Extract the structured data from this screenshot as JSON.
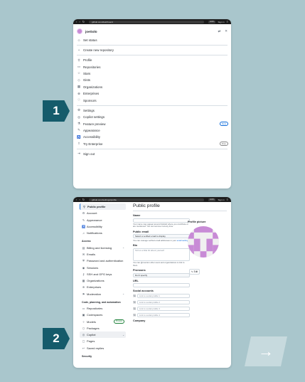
{
  "browser": {
    "url_top": "github.com/dashboard",
    "url_bottom": "github.com/settings/profile",
    "pill1": "100%",
    "pill2": "Sign in"
  },
  "menu": {
    "username": "joeSolo",
    "items_group1": [
      {
        "icon": "smiley-icon",
        "glyph": "☺",
        "label": "Set status"
      }
    ],
    "items_group2": [
      {
        "icon": "plus-icon",
        "glyph": "+",
        "label": "Create new repository"
      }
    ],
    "items_group3": [
      {
        "icon": "person-icon",
        "glyph": "⚲",
        "label": "Profile"
      },
      {
        "icon": "repo-icon",
        "glyph": "▭",
        "label": "Repositories"
      },
      {
        "icon": "star-icon",
        "glyph": "☆",
        "label": "Stars"
      },
      {
        "icon": "gist-icon",
        "glyph": "◇",
        "label": "Gists"
      },
      {
        "icon": "organization-icon",
        "glyph": "▦",
        "label": "Organizations"
      },
      {
        "icon": "globe-icon",
        "glyph": "⊕",
        "label": "Enterprises"
      },
      {
        "icon": "heart-icon",
        "glyph": "♡",
        "label": "Sponsors"
      }
    ],
    "items_group4": [
      {
        "icon": "gear-icon",
        "glyph": "⚙",
        "label": "Settings"
      },
      {
        "icon": "copilot-icon",
        "glyph": "◎",
        "label": "Copilot settings"
      },
      {
        "icon": "beaker-icon",
        "glyph": "⚗",
        "label": "Feature preview",
        "badge": "New"
      },
      {
        "icon": "paintbrush-icon",
        "glyph": "✎",
        "label": "Appearance"
      },
      {
        "icon": "accessibility-icon",
        "glyph": "♿",
        "label": "Accessibility"
      },
      {
        "icon": "upload-icon",
        "glyph": "⇧",
        "label": "Try Enterprise",
        "badge": "Free"
      }
    ],
    "items_group5": [
      {
        "icon": "sign-out-icon",
        "glyph": "⇥",
        "label": "Sign out"
      }
    ]
  },
  "settings": {
    "title": "Public profile",
    "sidebar_top": [
      {
        "icon": "person-icon",
        "glyph": "⚲",
        "label": "Public profile",
        "active": true
      },
      {
        "icon": "gear-icon",
        "glyph": "⚙",
        "label": "Account"
      },
      {
        "icon": "paintbrush-icon",
        "glyph": "✎",
        "label": "Appearance"
      },
      {
        "icon": "accessibility-icon",
        "glyph": "♿",
        "label": "Accessibility"
      },
      {
        "icon": "bell-icon",
        "glyph": "♫",
        "label": "Notifications"
      }
    ],
    "section_access": "Access",
    "sidebar_access": [
      {
        "icon": "billing-icon",
        "glyph": "▤",
        "label": "Billing and licensing",
        "chevron": true
      },
      {
        "icon": "mail-icon",
        "glyph": "✉",
        "label": "Emails"
      },
      {
        "icon": "shield-icon",
        "glyph": "⛨",
        "label": "Password and authentication"
      },
      {
        "icon": "broadcast-icon",
        "glyph": "◉",
        "label": "Sessions"
      },
      {
        "icon": "key-icon",
        "glyph": "⚷",
        "label": "SSH and GPG keys"
      },
      {
        "icon": "organization-icon",
        "glyph": "▦",
        "label": "Organizations"
      },
      {
        "icon": "globe-icon",
        "glyph": "⊕",
        "label": "Enterprises"
      },
      {
        "icon": "moderation-icon",
        "glyph": "⚑",
        "label": "Moderation",
        "chevron": true
      }
    ],
    "section_code": "Code, planning, and automation",
    "sidebar_code": [
      {
        "icon": "repo-icon",
        "glyph": "▭",
        "label": "Repositories"
      },
      {
        "icon": "codespaces-icon",
        "glyph": "▣",
        "label": "Codespaces"
      },
      {
        "icon": "models-icon",
        "glyph": "✧",
        "label": "Models",
        "preview": "Preview"
      },
      {
        "icon": "package-icon",
        "glyph": "⬡",
        "label": "Packages"
      },
      {
        "icon": "copilot-icon",
        "glyph": "◎",
        "label": "Copilot",
        "chevron": true,
        "highlight": true
      },
      {
        "icon": "pages-icon",
        "glyph": "▢",
        "label": "Pages"
      },
      {
        "icon": "reply-icon",
        "glyph": "↩",
        "label": "Saved replies"
      }
    ],
    "section_security": "Security",
    "form": {
      "name_label": "Name",
      "name_note": "Your name may appear around GitHub where you contribute or are mentioned. You can remove it at any time.",
      "email_label": "Public email",
      "email_value": "Select a verified email to display",
      "email_note_prefix": "You can manage verified email addresses in your",
      "email_note_link": "email settings",
      "bio_label": "Bio",
      "bio_placeholder": "Tell us a little bit about yourself",
      "bio_note": "You can @mention other users and organizations to link to them.",
      "pronouns_label": "Pronouns",
      "pronouns_value": "Don't specify",
      "url_label": "URL",
      "social_label": "Social accounts",
      "social_placeholders": [
        "Link to social profile 1",
        "Link to social profile 2",
        "Link to social profile 3",
        "Link to social profile 4"
      ],
      "company_label": "Company"
    },
    "picture_label": "Profile picture",
    "edit_label": "Edit"
  },
  "steps": {
    "one": "1",
    "two": "2",
    "next_glyph": "→"
  },
  "colors": {
    "accent": "#0969da",
    "step_bg": "#155b6b",
    "page_bg": "#a9c6cc",
    "avatar": "#c88bd6"
  }
}
